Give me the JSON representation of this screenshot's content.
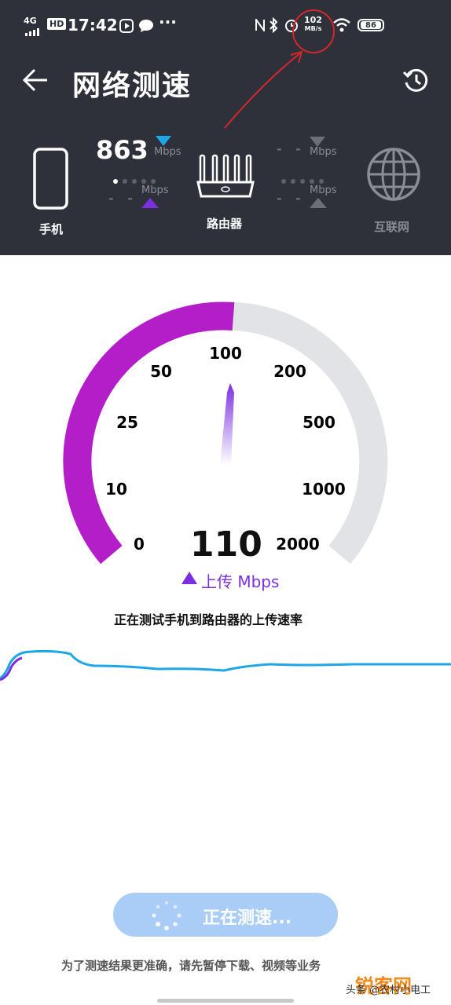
{
  "status_bar": {
    "signal": "4G",
    "hd": "HD",
    "time": "17:42",
    "more": "···",
    "net_speed_value": "102",
    "net_speed_unit": "MB/s",
    "battery": "86"
  },
  "header": {
    "title": "网络测速"
  },
  "devices": {
    "phone_label": "手机",
    "router_label": "路由器",
    "internet_label": "互联网"
  },
  "link_left": {
    "download_value": "863",
    "download_unit": "Mbps",
    "upload_placeholder": "- -",
    "upload_unit": "Mbps"
  },
  "link_right": {
    "download_placeholder": "- -",
    "download_unit": "Mbps",
    "upload_placeholder": "- -",
    "upload_unit": "Mbps"
  },
  "gauge": {
    "scale_labels": [
      "0",
      "10",
      "25",
      "50",
      "100",
      "200",
      "500",
      "1000",
      "2000"
    ],
    "current_value": "110",
    "direction_label": "上传 Mbps",
    "colors": {
      "active": "#b41ec8",
      "inactive": "#e2e3e6"
    }
  },
  "status_text": "正在测试手机到路由器的上传速率",
  "action_button": {
    "label": "正在测速..."
  },
  "tip": "为了测速结果更准确，请先暂停下载、视频等业务",
  "watermark": "锐客网",
  "watermark_sub": "头条 @农村小电工",
  "colors": {
    "header_bg": "#2e313a",
    "accent_blue": "#1fa6e6",
    "accent_purple": "#7b2fe0"
  }
}
